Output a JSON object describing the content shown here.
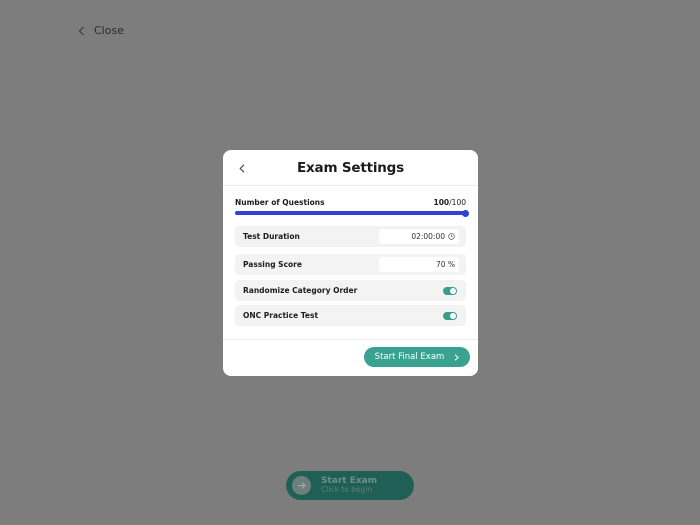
{
  "background": {
    "close_label": "Close",
    "start_exam": {
      "title": "Start Exam",
      "subtitle": "Click to begin"
    }
  },
  "modal": {
    "title": "Exam Settings",
    "questions": {
      "label": "Number of Questions",
      "value": "100",
      "max": "/100",
      "slider_fraction": 1.0
    },
    "settings": [
      {
        "label": "Test Duration",
        "value": "02:00:00",
        "icon": "clock-icon"
      },
      {
        "label": "Passing Score",
        "value": "70 %"
      },
      {
        "label": "Randomize Category Order",
        "toggle": true
      },
      {
        "label": "ONC Practice Test",
        "toggle": true
      }
    ],
    "start_button_label": "Start Final Exam"
  },
  "colors": {
    "overlay": "#7d7d7d",
    "accent_teal": "#3aa291",
    "slider_blue": "#2f43d8"
  }
}
